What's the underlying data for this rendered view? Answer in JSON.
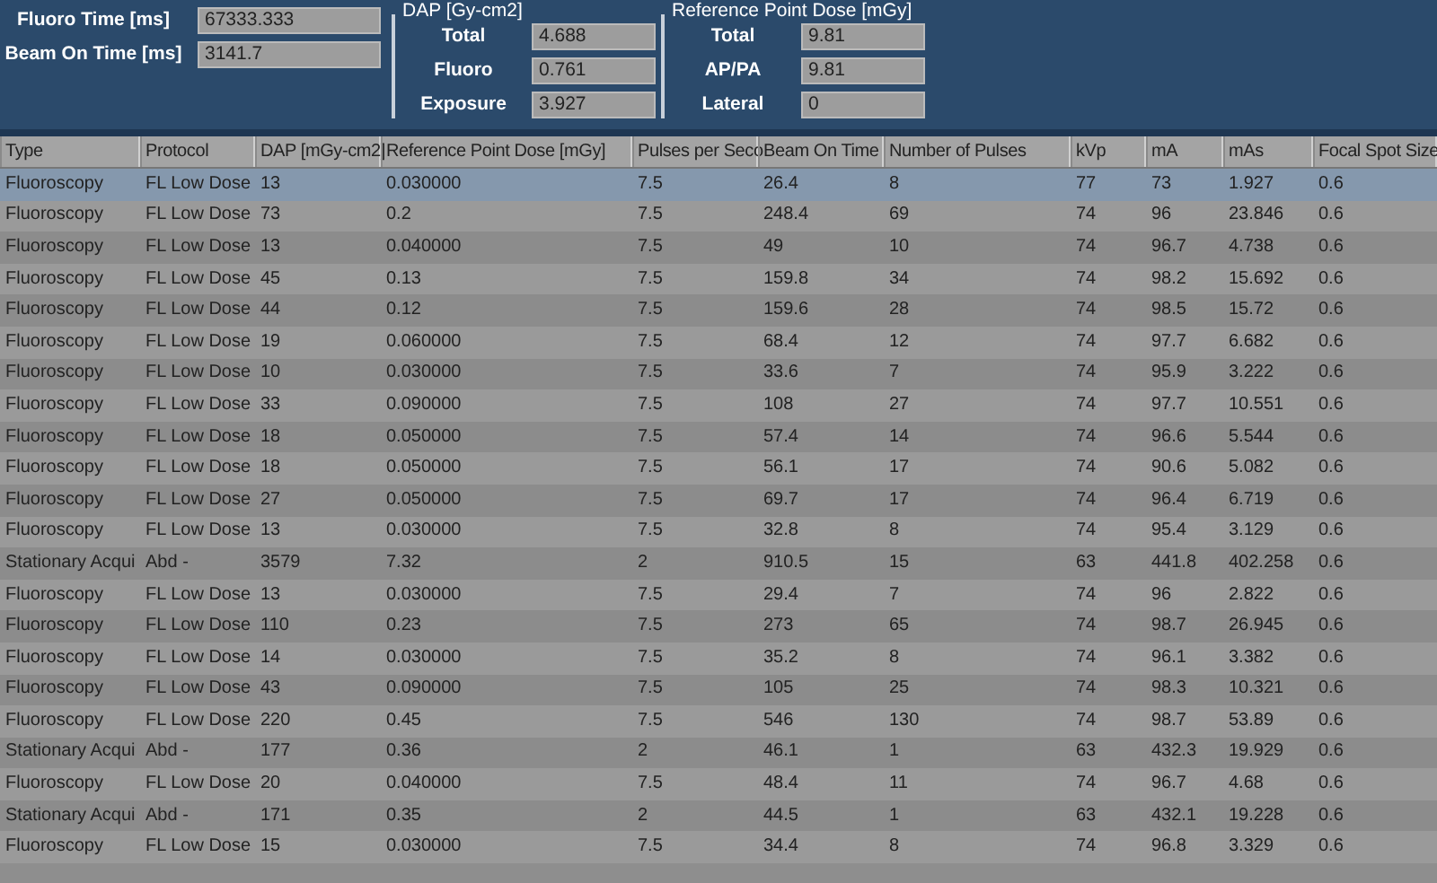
{
  "summary": {
    "time_fields": [
      {
        "label": "Fluoro Time [ms]",
        "value": "67333.333"
      },
      {
        "label": "Beam On Time [ms]",
        "value": "3141.7"
      }
    ],
    "groups": [
      {
        "title": "DAP [Gy-cm2]",
        "fields": [
          {
            "label": "Total",
            "value": "4.688"
          },
          {
            "label": "Fluoro",
            "value": "0.761"
          },
          {
            "label": "Exposure",
            "value": "3.927"
          }
        ]
      },
      {
        "title": "Reference Point Dose [mGy]",
        "fields": [
          {
            "label": "Total",
            "value": "9.81"
          },
          {
            "label": "AP/PA",
            "value": "9.81"
          },
          {
            "label": "Lateral",
            "value": "0"
          }
        ]
      }
    ]
  },
  "table": {
    "columns": [
      "Type",
      "Protocol",
      "DAP [mGy-cm2]",
      "Reference Point Dose [mGy]",
      "Pulses per Seco",
      "Beam On Time",
      "Number of Pulses",
      "kVp",
      "mA",
      "mAs",
      "Focal Spot Size"
    ],
    "rows": [
      {
        "selected": true,
        "cells": [
          "Fluoroscopy",
          "FL Low Dose",
          "13",
          "0.030000",
          "7.5",
          "26.4",
          "8",
          "77",
          "73",
          "1.927",
          "0.6"
        ]
      },
      {
        "selected": false,
        "cells": [
          "Fluoroscopy",
          "FL Low Dose",
          "73",
          "0.2",
          "7.5",
          "248.4",
          "69",
          "74",
          "96",
          "23.846",
          "0.6"
        ]
      },
      {
        "selected": false,
        "cells": [
          "Fluoroscopy",
          "FL Low Dose",
          "13",
          "0.040000",
          "7.5",
          "49",
          "10",
          "74",
          "96.7",
          "4.738",
          "0.6"
        ]
      },
      {
        "selected": false,
        "cells": [
          "Fluoroscopy",
          "FL Low Dose",
          "45",
          "0.13",
          "7.5",
          "159.8",
          "34",
          "74",
          "98.2",
          "15.692",
          "0.6"
        ]
      },
      {
        "selected": false,
        "cells": [
          "Fluoroscopy",
          "FL Low Dose",
          "44",
          "0.12",
          "7.5",
          "159.6",
          "28",
          "74",
          "98.5",
          "15.72",
          "0.6"
        ]
      },
      {
        "selected": false,
        "cells": [
          "Fluoroscopy",
          "FL Low Dose",
          "19",
          "0.060000",
          "7.5",
          "68.4",
          "12",
          "74",
          "97.7",
          "6.682",
          "0.6"
        ]
      },
      {
        "selected": false,
        "cells": [
          "Fluoroscopy",
          "FL Low Dose",
          "10",
          "0.030000",
          "7.5",
          "33.6",
          "7",
          "74",
          "95.9",
          "3.222",
          "0.6"
        ]
      },
      {
        "selected": false,
        "cells": [
          "Fluoroscopy",
          "FL Low Dose",
          "33",
          "0.090000",
          "7.5",
          "108",
          "27",
          "74",
          "97.7",
          "10.551",
          "0.6"
        ]
      },
      {
        "selected": false,
        "cells": [
          "Fluoroscopy",
          "FL Low Dose",
          "18",
          "0.050000",
          "7.5",
          "57.4",
          "14",
          "74",
          "96.6",
          "5.544",
          "0.6"
        ]
      },
      {
        "selected": false,
        "cells": [
          "Fluoroscopy",
          "FL Low Dose",
          "18",
          "0.050000",
          "7.5",
          "56.1",
          "17",
          "74",
          "90.6",
          "5.082",
          "0.6"
        ]
      },
      {
        "selected": false,
        "cells": [
          "Fluoroscopy",
          "FL Low Dose",
          "27",
          "0.050000",
          "7.5",
          "69.7",
          "17",
          "74",
          "96.4",
          "6.719",
          "0.6"
        ]
      },
      {
        "selected": false,
        "cells": [
          "Fluoroscopy",
          "FL Low Dose",
          "13",
          "0.030000",
          "7.5",
          "32.8",
          "8",
          "74",
          "95.4",
          "3.129",
          "0.6"
        ]
      },
      {
        "selected": false,
        "cells": [
          "Stationary Acqui",
          "Abd -",
          "3579",
          "7.32",
          "2",
          "910.5",
          "15",
          "63",
          "441.8",
          "402.258",
          "0.6"
        ]
      },
      {
        "selected": false,
        "cells": [
          "Fluoroscopy",
          "FL Low Dose",
          "13",
          "0.030000",
          "7.5",
          "29.4",
          "7",
          "74",
          "96",
          "2.822",
          "0.6"
        ]
      },
      {
        "selected": false,
        "cells": [
          "Fluoroscopy",
          "FL Low Dose",
          "110",
          "0.23",
          "7.5",
          "273",
          "65",
          "74",
          "98.7",
          "26.945",
          "0.6"
        ]
      },
      {
        "selected": false,
        "cells": [
          "Fluoroscopy",
          "FL Low Dose",
          "14",
          "0.030000",
          "7.5",
          "35.2",
          "8",
          "74",
          "96.1",
          "3.382",
          "0.6"
        ]
      },
      {
        "selected": false,
        "cells": [
          "Fluoroscopy",
          "FL Low Dose",
          "43",
          "0.090000",
          "7.5",
          "105",
          "25",
          "74",
          "98.3",
          "10.321",
          "0.6"
        ]
      },
      {
        "selected": false,
        "cells": [
          "Fluoroscopy",
          "FL Low Dose",
          "220",
          "0.45",
          "7.5",
          "546",
          "130",
          "74",
          "98.7",
          "53.89",
          "0.6"
        ]
      },
      {
        "selected": false,
        "cells": [
          "Stationary Acqui",
          "Abd -",
          "177",
          "0.36",
          "2",
          "46.1",
          "1",
          "63",
          "432.3",
          "19.929",
          "0.6"
        ]
      },
      {
        "selected": false,
        "cells": [
          "Fluoroscopy",
          "FL Low Dose",
          "20",
          "0.040000",
          "7.5",
          "48.4",
          "11",
          "74",
          "96.7",
          "4.68",
          "0.6"
        ]
      },
      {
        "selected": false,
        "cells": [
          "Stationary Acqui",
          "Abd -",
          "171",
          "0.35",
          "2",
          "44.5",
          "1",
          "63",
          "432.1",
          "19.228",
          "0.6"
        ]
      },
      {
        "selected": false,
        "cells": [
          "Fluoroscopy",
          "FL Low Dose",
          "15",
          "0.030000",
          "7.5",
          "34.4",
          "8",
          "74",
          "96.8",
          "3.329",
          "0.6"
        ]
      }
    ]
  }
}
